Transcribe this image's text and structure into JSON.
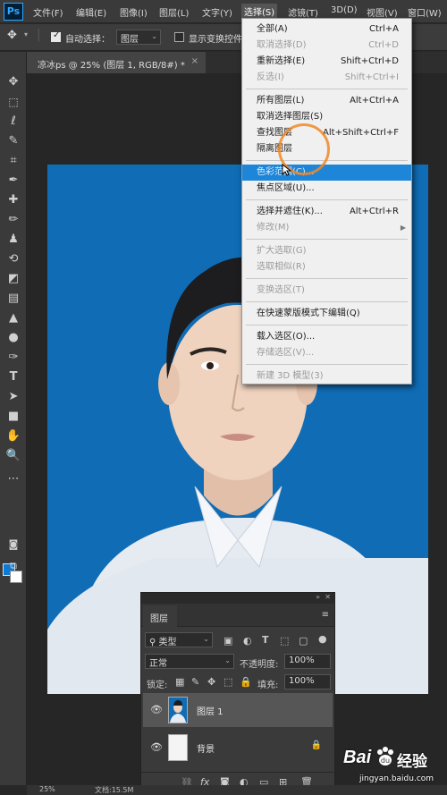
{
  "menubar": {
    "logo": "Ps",
    "items": [
      "文件(F)",
      "编辑(E)",
      "图像(I)",
      "图层(L)",
      "文字(Y)",
      "选择(S)",
      "滤镜(T)",
      "3D(D)",
      "视图(V)",
      "窗口(W)"
    ],
    "active_index": 5
  },
  "options": {
    "auto_select_label": "自动选择：",
    "auto_select_value": "图层",
    "show_transform_label": "显示变换控件"
  },
  "document": {
    "tab_title": "凉冰ps @ 25% (图层 1, RGB/8#) *",
    "close": "×"
  },
  "dropdown": {
    "items": [
      {
        "label": "全部(A)",
        "shortcut": "Ctrl+A",
        "disabled": false
      },
      {
        "label": "取消选择(D)",
        "shortcut": "Ctrl+D",
        "disabled": true
      },
      {
        "label": "重新选择(E)",
        "shortcut": "Shift+Ctrl+D",
        "disabled": false
      },
      {
        "label": "反选(I)",
        "shortcut": "Shift+Ctrl+I",
        "disabled": true
      },
      {
        "label": "所有图层(L)",
        "shortcut": "Alt+Ctrl+A",
        "disabled": false
      },
      {
        "label": "取消选择图层(S)",
        "shortcut": "",
        "disabled": false
      },
      {
        "label": "查找图层",
        "shortcut": "Alt+Shift+Ctrl+F",
        "disabled": false
      },
      {
        "label": "隔离图层",
        "shortcut": "",
        "disabled": false
      },
      {
        "label": "色彩范围(C)...",
        "shortcut": "",
        "disabled": false,
        "highlighted": true
      },
      {
        "label": "焦点区域(U)...",
        "shortcut": "",
        "disabled": false
      },
      {
        "label": "选择并遮住(K)...",
        "shortcut": "Alt+Ctrl+R",
        "disabled": false
      },
      {
        "label": "修改(M)",
        "shortcut": "",
        "disabled": true,
        "submenu": true
      },
      {
        "label": "扩大选取(G)",
        "shortcut": "",
        "disabled": true
      },
      {
        "label": "选取相似(R)",
        "shortcut": "",
        "disabled": true
      },
      {
        "label": "变换选区(T)",
        "shortcut": "",
        "disabled": true
      },
      {
        "label": "在快速蒙版模式下编辑(Q)",
        "shortcut": "",
        "disabled": false
      },
      {
        "label": "载入选区(O)...",
        "shortcut": "",
        "disabled": false
      },
      {
        "label": "存储选区(V)...",
        "shortcut": "",
        "disabled": true
      },
      {
        "label": "新建 3D 模型(3)",
        "shortcut": "",
        "disabled": true
      }
    ]
  },
  "layers_panel": {
    "tab": "图层",
    "filter_kind": "类型",
    "blend_mode": "正常",
    "opacity_label": "不透明度:",
    "opacity_value": "100%",
    "lock_label": "锁定:",
    "fill_label": "填充:",
    "fill_value": "100%",
    "layers": [
      {
        "name": "图层 1",
        "selected": true
      },
      {
        "name": "背景",
        "selected": false,
        "locked": true
      }
    ]
  },
  "status": {
    "zoom": "25%",
    "doc_info": "文档:15.5M"
  },
  "colors": {
    "foreground": "#0b7bd6",
    "background": "#ffffff",
    "photo_backdrop": "#0f6cb5",
    "menu_highlight": "#1e86d8"
  },
  "watermark": {
    "brand": "Bai",
    "brand_suffix": "经验",
    "url": "jingyan.baidu.com"
  }
}
